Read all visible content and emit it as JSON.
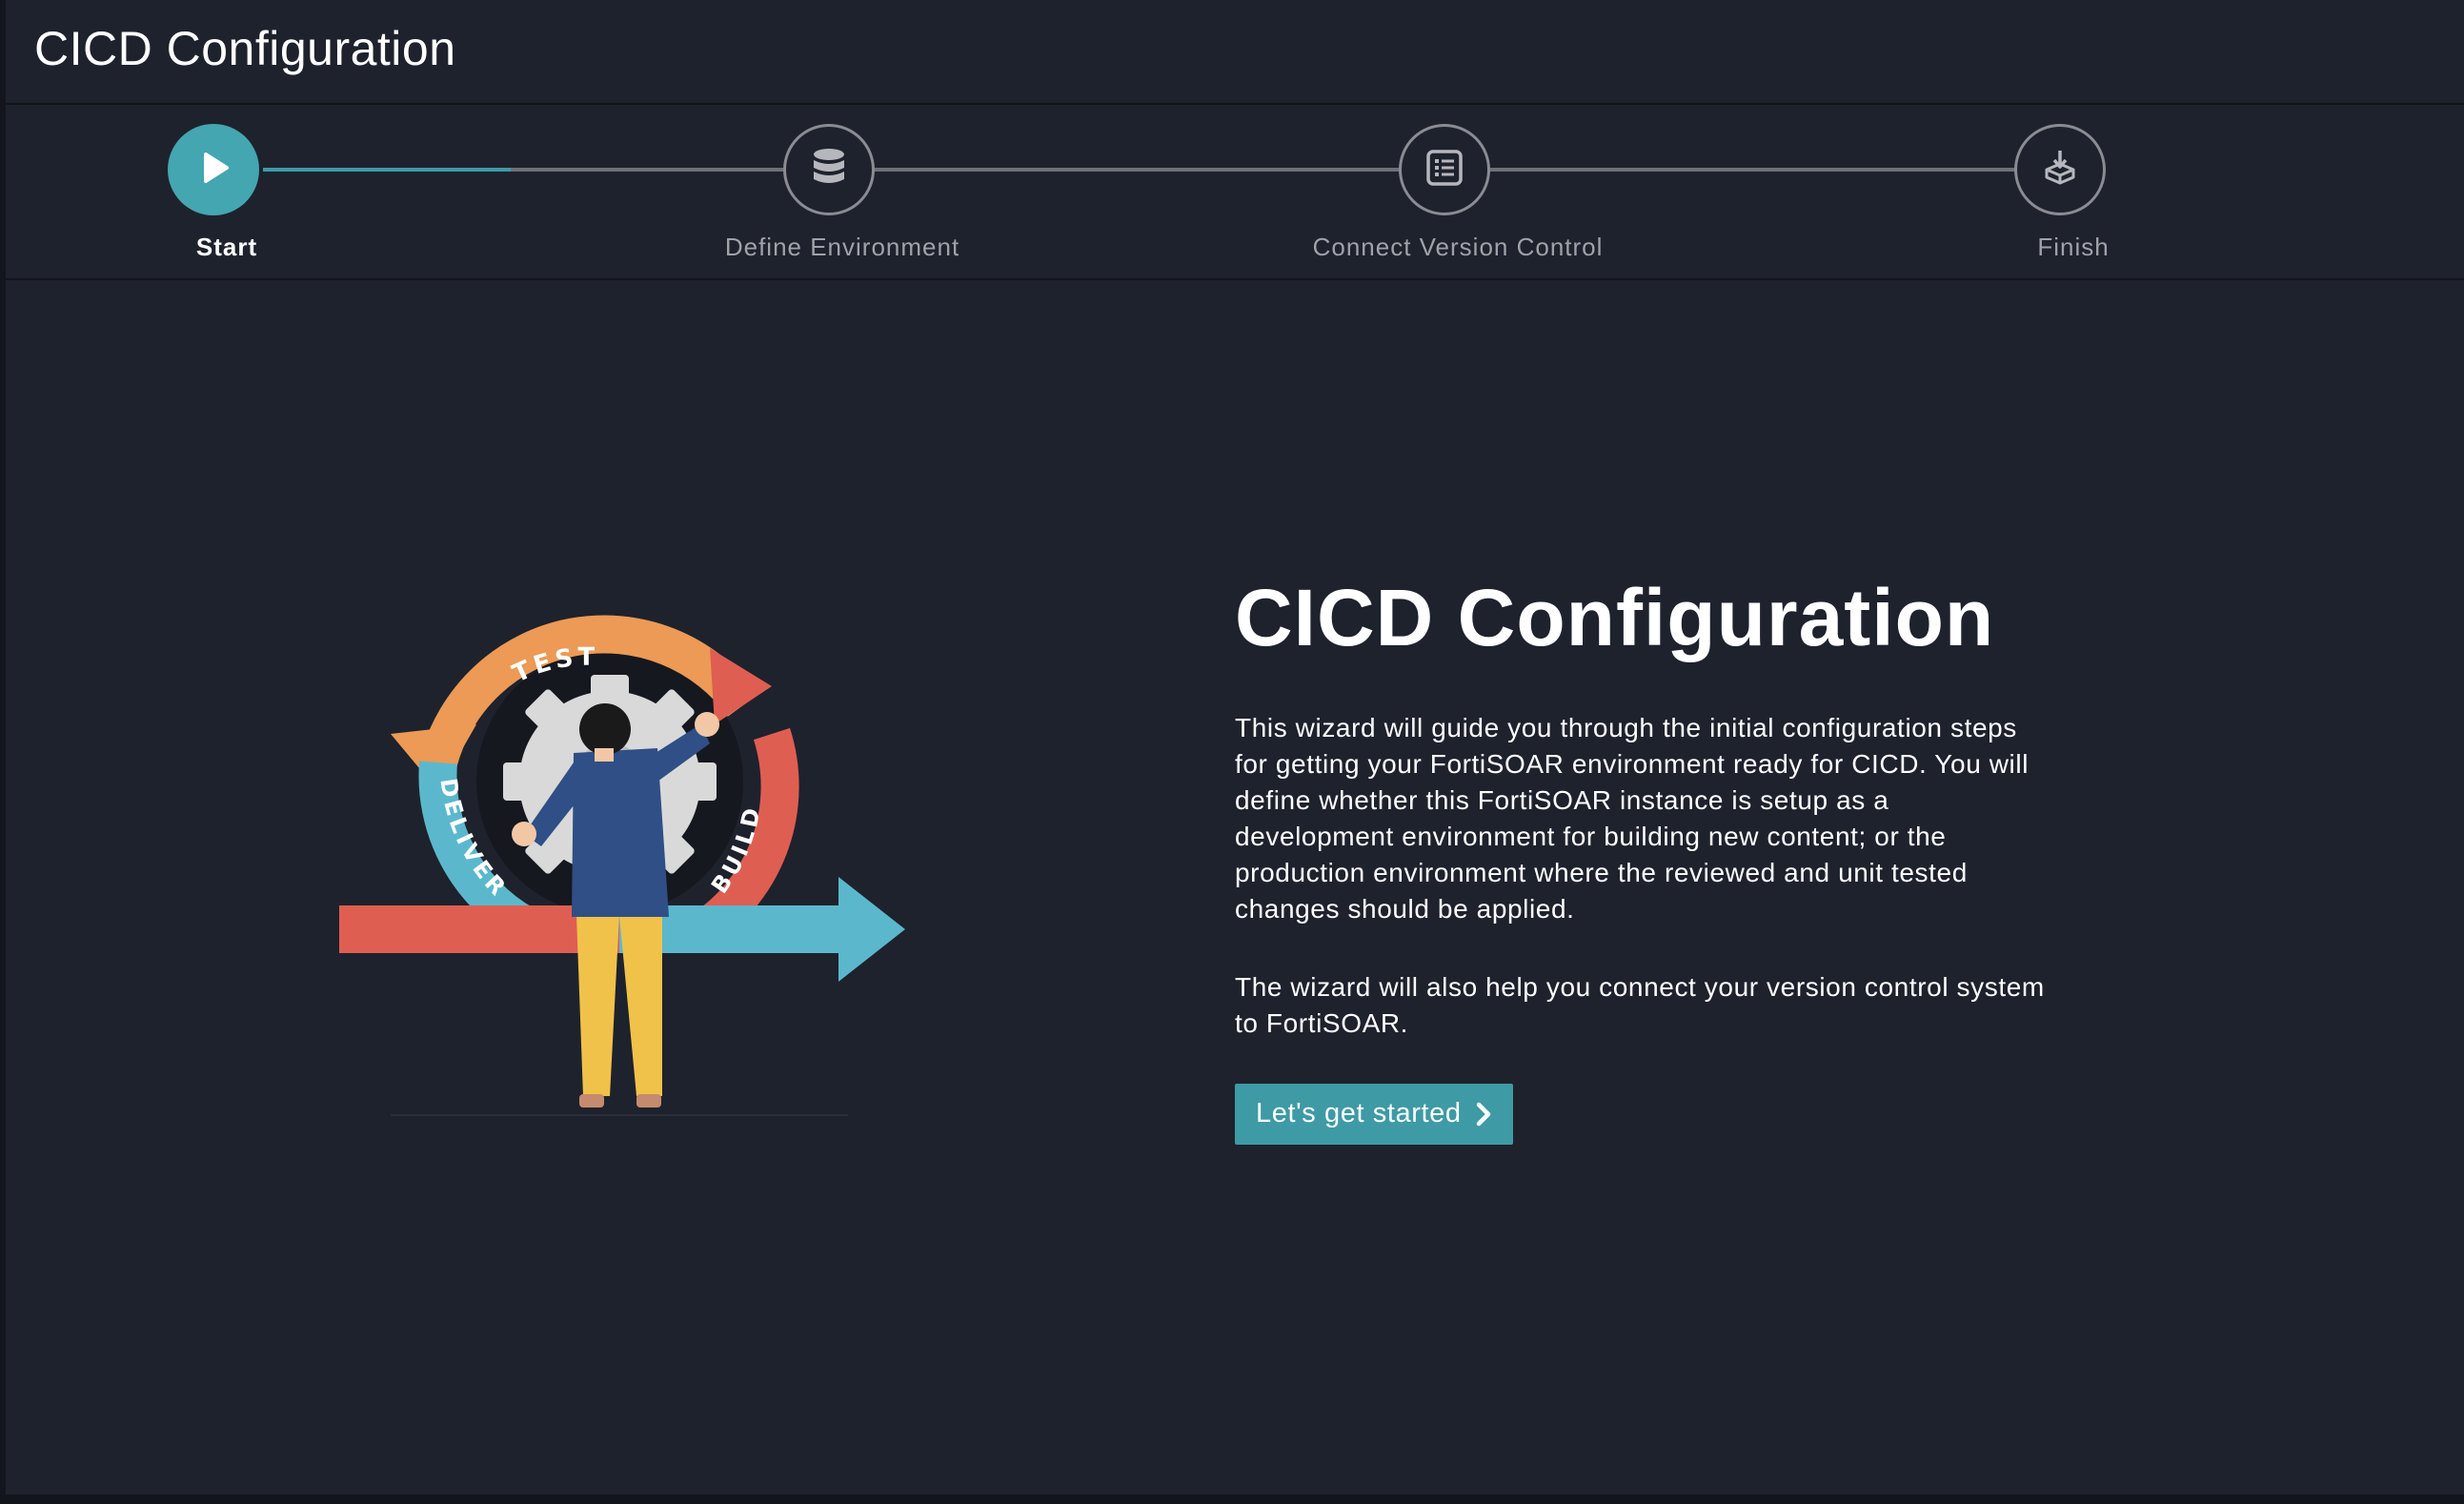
{
  "header": {
    "title": "CICD Configuration"
  },
  "stepper": {
    "steps": [
      {
        "label": "Start",
        "icon": "play-icon",
        "active": true
      },
      {
        "label": "Define Environment",
        "icon": "database-icon",
        "active": false
      },
      {
        "label": "Connect Version Control",
        "icon": "list-icon",
        "active": false
      },
      {
        "label": "Finish",
        "icon": "deploy-box-icon",
        "active": false
      }
    ]
  },
  "illustration": {
    "cycle_labels": {
      "top": "TEST",
      "left": "DELIVER",
      "right": "BUILD"
    }
  },
  "main": {
    "title": "CICD Configuration",
    "paragraph1": "This wizard will guide you through the initial configuration steps for getting your FortiSOAR environment ready for CICD. You will define whether this FortiSOAR instance is setup as a development environment for building new content; or the production environment where the reviewed and unit tested changes should be applied.",
    "paragraph2": "The wizard will also help you connect your version control system to FortiSOAR.",
    "cta_label": "Let's get started"
  },
  "colors": {
    "background": "#1e222d",
    "accent": "#44a6b0",
    "text": "#ffffff",
    "muted": "#a0a2a8"
  }
}
